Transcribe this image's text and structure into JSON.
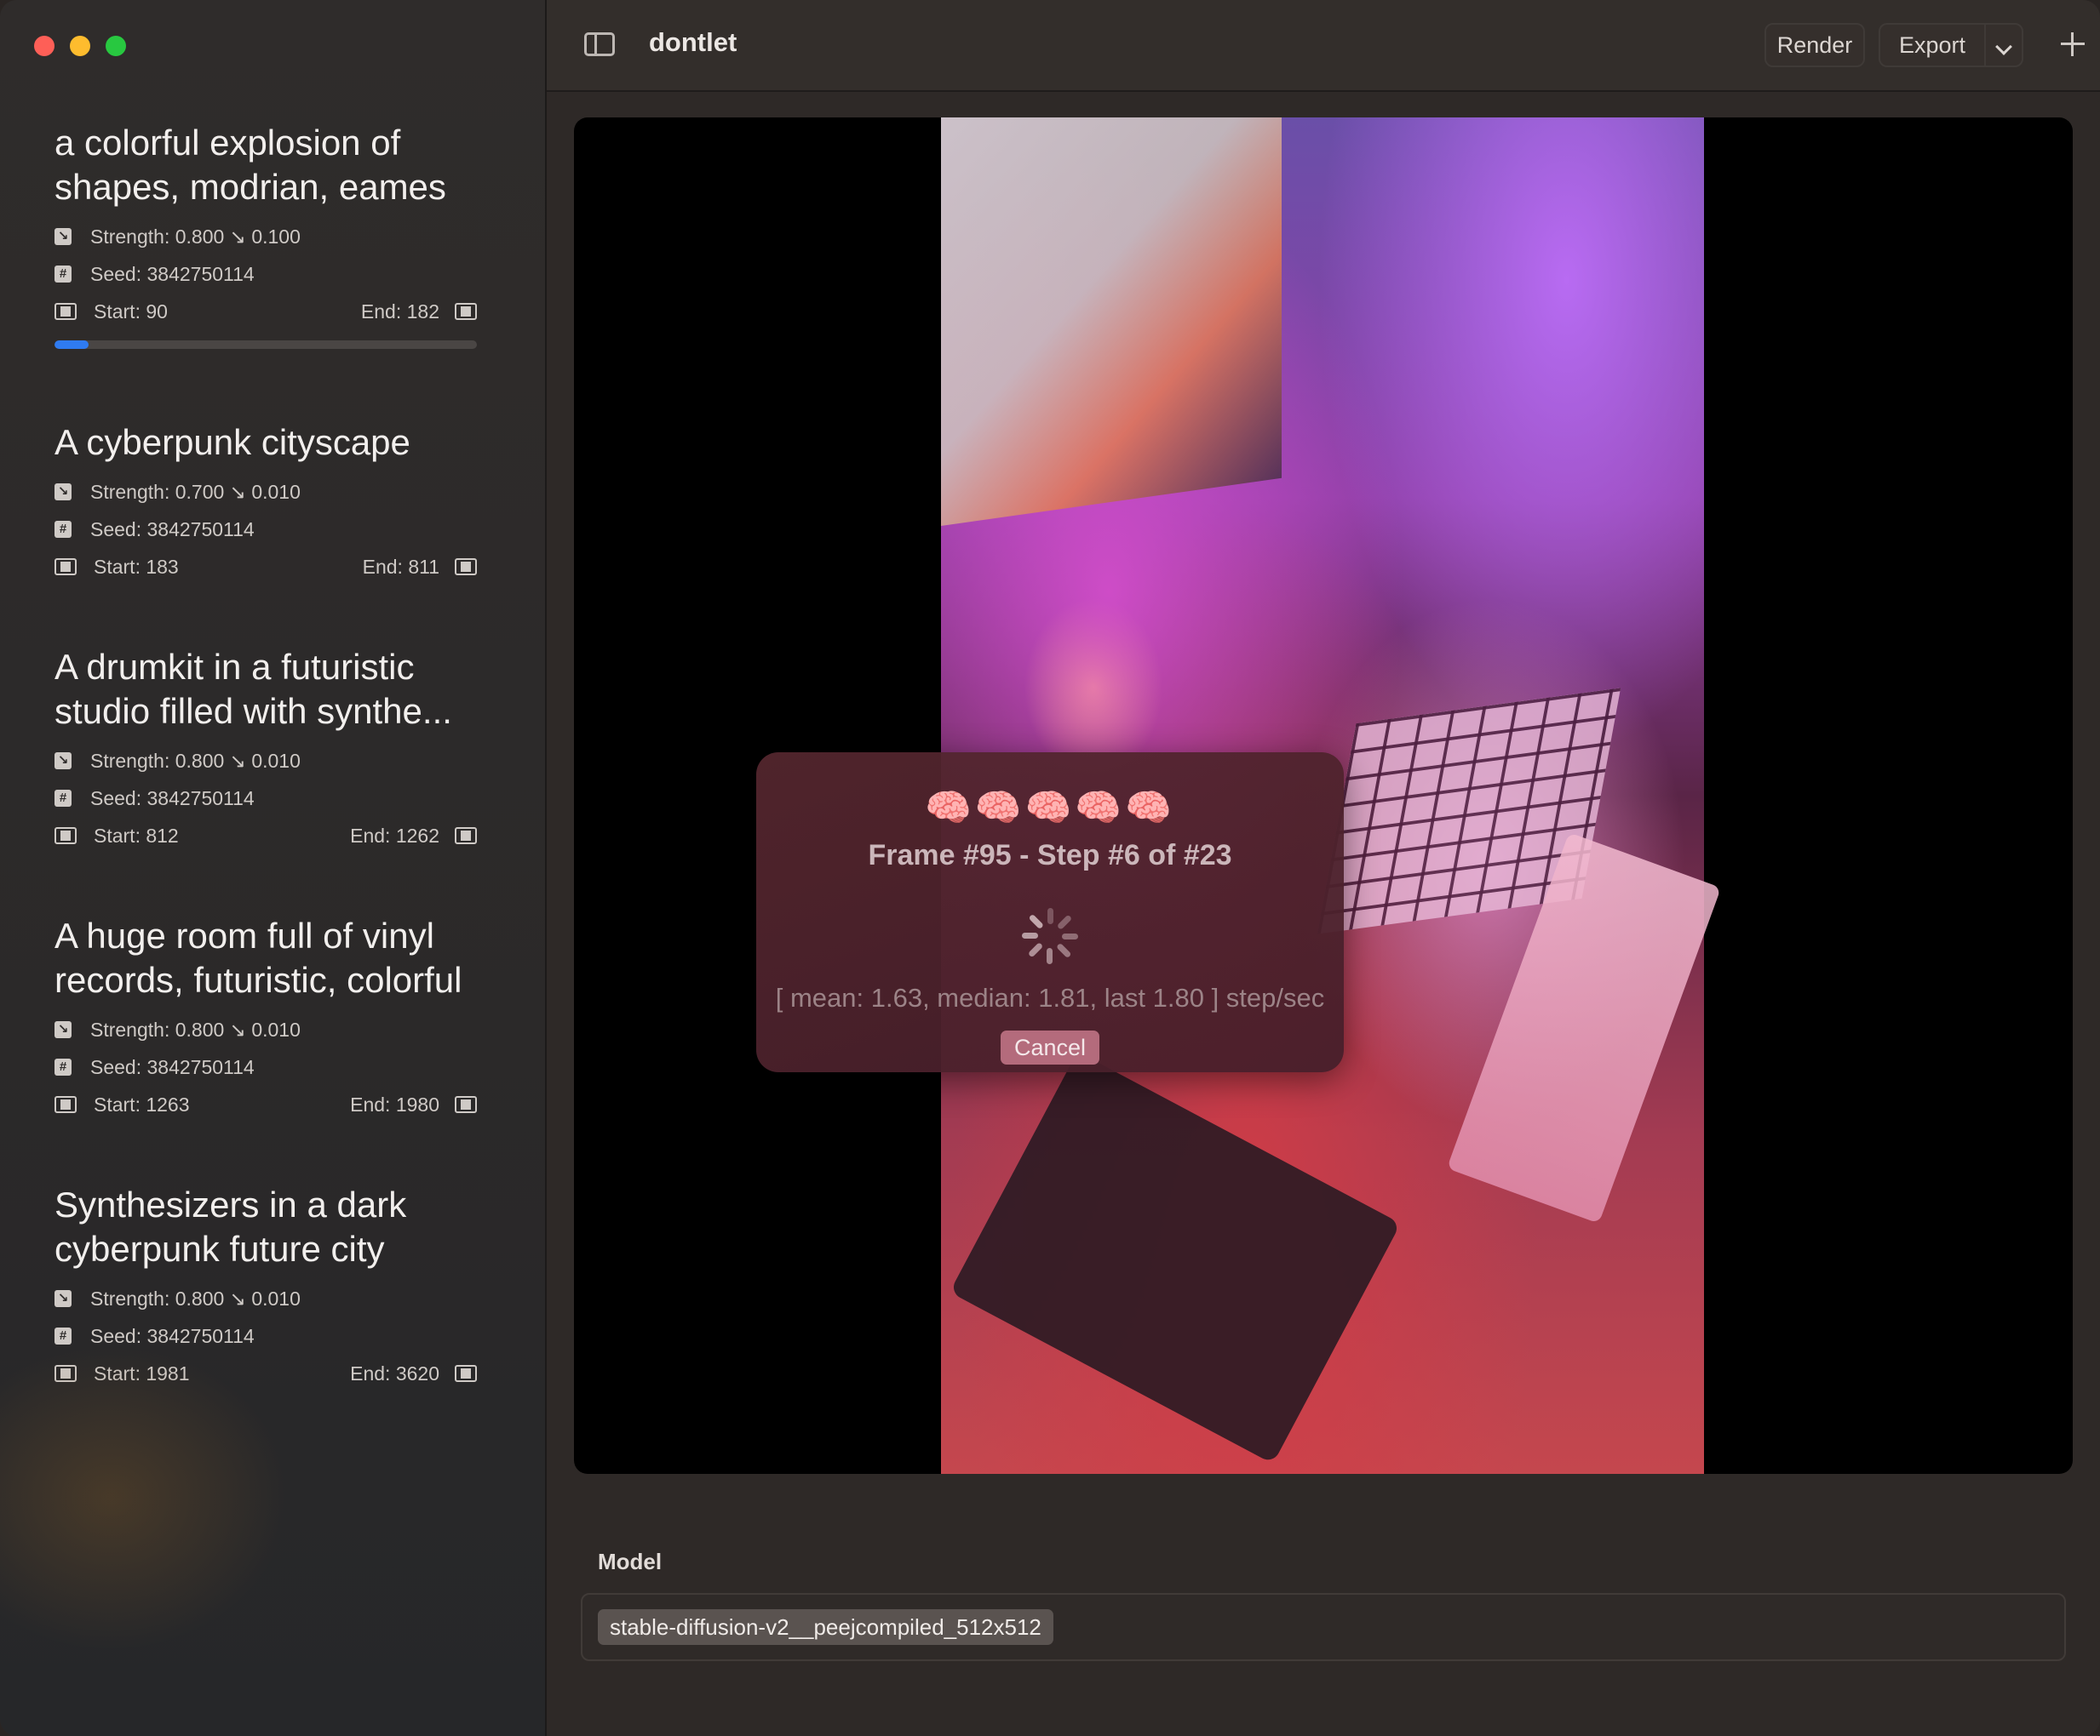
{
  "window": {
    "title": "dontlet",
    "toolbar": {
      "render_label": "Render",
      "export_label": "Export"
    }
  },
  "sidebar": {
    "items": [
      {
        "title": "a colorful explosion of shapes, modrian, eames",
        "strength": "Strength: 0.800 ↘ 0.100",
        "seed": "Seed: 3842750114",
        "start": "Start: 90",
        "end": "End: 182",
        "progress": 0.08
      },
      {
        "title": "A cyberpunk cityscape",
        "strength": "Strength: 0.700 ↘ 0.010",
        "seed": "Seed: 3842750114",
        "start": "Start: 183",
        "end": "End: 811"
      },
      {
        "title": "A drumkit in a futuristic studio filled with synthe...",
        "strength": "Strength: 0.800 ↘ 0.010",
        "seed": "Seed: 3842750114",
        "start": "Start: 812",
        "end": "End: 1262"
      },
      {
        "title": "A huge room full of vinyl records, futuristic, colorful",
        "strength": "Strength: 0.800 ↘ 0.010",
        "seed": "Seed: 3842750114",
        "start": "Start: 1263",
        "end": "End: 1980"
      },
      {
        "title": "Synthesizers in a dark cyberpunk future city",
        "strength": "Strength: 0.800 ↘ 0.010",
        "seed": "Seed: 3842750114",
        "start": "Start: 1981",
        "end": "End: 3620"
      }
    ]
  },
  "overlay": {
    "emojis": "🧠🧠🧠🧠🧠",
    "status": "Frame #95 - Step #6 of #23",
    "stats": "[ mean: 1.63, median: 1.81, last 1.80 ] step/sec",
    "cancel_label": "Cancel"
  },
  "model": {
    "label": "Model",
    "value": "stable-diffusion-v2__peejcompiled_512x512"
  },
  "icons": {
    "strength": "strength-icon",
    "seed": "hash-icon",
    "frames": "film-icon",
    "sidebar_toggle": "sidebar-toggle-icon",
    "add": "plus-icon"
  },
  "colors": {
    "progress_fill": "#2f7bf0",
    "close": "#fe5f57",
    "minimize": "#febc2e",
    "zoom": "#28c840",
    "cancel_button": "#b46b7c"
  }
}
